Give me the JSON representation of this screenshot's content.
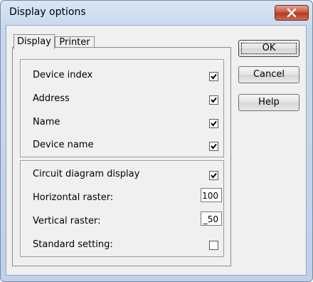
{
  "window": {
    "title": "Display options"
  },
  "tabs": [
    {
      "label": "Display"
    },
    {
      "label": "Printer"
    }
  ],
  "group1": {
    "rows": [
      {
        "label": "Device index",
        "checked": true
      },
      {
        "label": "Address",
        "checked": true
      },
      {
        "label": "Name",
        "checked": true
      },
      {
        "label": "Device name",
        "checked": true
      }
    ]
  },
  "group2": {
    "circuit_label": "Circuit diagram display",
    "circuit_checked": true,
    "horizontal_label": "Horizontal raster:",
    "horizontal_value": "100",
    "vertical_label": "Vertical raster:",
    "vertical_value": "_50",
    "standard_label": "Standard setting:",
    "standard_checked": false
  },
  "buttons": {
    "ok": "OK",
    "cancel": "Cancel",
    "help": "Help"
  },
  "icons": {
    "close": "close-icon",
    "checkmark": "checkmark-icon"
  }
}
